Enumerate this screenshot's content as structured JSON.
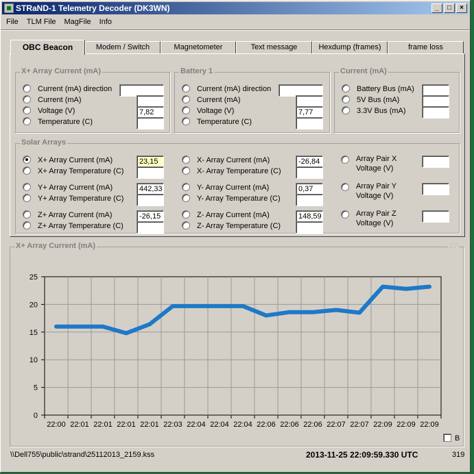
{
  "window": {
    "title": "STRaND-1 Telemetry Decoder (DK3WN)",
    "minimize": "_",
    "maximize": "□",
    "close": "×"
  },
  "menu": [
    "File",
    "TLM File",
    "MagFile",
    "Info"
  ],
  "tabs": [
    "OBC Beacon",
    "Modem / Switch",
    "Magnetometer",
    "Text message",
    "Hexdump (frames)",
    "frame loss"
  ],
  "xplus": {
    "title": "X+ Array Current (mA)",
    "rows": [
      {
        "label": "Current (mA) direction",
        "value": ""
      },
      {
        "label": "Current (mA)",
        "value": ""
      },
      {
        "label": "Voltage (V)",
        "value": "7,82"
      },
      {
        "label": "Temperature (C)",
        "value": ""
      }
    ]
  },
  "battery": {
    "title": "Battery 1",
    "rows": [
      {
        "label": "Current (mA) direction",
        "value": ""
      },
      {
        "label": "Current (mA)",
        "value": ""
      },
      {
        "label": "Voltage (V)",
        "value": "7,77"
      },
      {
        "label": "Temperature (C)",
        "value": ""
      }
    ]
  },
  "current": {
    "title": "Current (mA)",
    "rows": [
      {
        "label": "Battery Bus (mA)",
        "value": ""
      },
      {
        "label": "5V Bus (mA)",
        "value": ""
      },
      {
        "label": "3.3V Bus (mA)",
        "value": ""
      }
    ]
  },
  "solar": {
    "title": "Solar Arrays",
    "col1": [
      {
        "label": "X+ Array Current (mA)",
        "value": "23,15"
      },
      {
        "label": "X+ Array Temperature (C)",
        "value": ""
      },
      {
        "label": "Y+ Array Current (mA)",
        "value": "442,33"
      },
      {
        "label": "Y+ Array Temperature (C)",
        "value": ""
      },
      {
        "label": "Z+ Array Current (mA)",
        "value": "-26,15"
      },
      {
        "label": "Z+ Array Temperature (C)",
        "value": ""
      }
    ],
    "col2": [
      {
        "label": "X- Array Current (mA)",
        "value": "-26,84"
      },
      {
        "label": "X- Array Temperature (C)",
        "value": ""
      },
      {
        "label": "Y- Array Current (mA)",
        "value": "0,37"
      },
      {
        "label": "Y- Array Temperature (C)",
        "value": ""
      },
      {
        "label": "Z- Array Current (mA)",
        "value": "148,59"
      },
      {
        "label": "Z- Array Temperature (C)",
        "value": ""
      }
    ],
    "col3": [
      {
        "line1": "Array Pair X",
        "line2": "Voltage (V)",
        "value": ""
      },
      {
        "line1": "Array Pair Y",
        "line2": "Voltage (V)",
        "value": ""
      },
      {
        "line1": "Array Pair Z",
        "line2": "Voltage (V)",
        "value": ""
      }
    ]
  },
  "chart_panel": {
    "title": "X+ Array Current (mA)",
    "count": "17",
    "checkbox_label": "B"
  },
  "status": {
    "path": "\\\\Dell755\\public\\strand\\25112013_2159.kss",
    "datetime": "2013-11-25  22:09:59.330 UTC",
    "count": "319"
  },
  "colors": {
    "series": "#1f78c8",
    "titlebar_start": "#0a246a",
    "highlight": "#ffffc0"
  },
  "chart_data": {
    "type": "line",
    "title": "X+ Array Current (mA)",
    "xlabel": "",
    "ylabel": "",
    "ylim": [
      0,
      25
    ],
    "yticks": [
      0,
      5,
      10,
      15,
      20,
      25
    ],
    "categories": [
      "22:00",
      "22:01",
      "22:01",
      "22:01",
      "22:01",
      "22:03",
      "22:04",
      "22:04",
      "22:04",
      "22:06",
      "22:06",
      "22:06",
      "22:07",
      "22:07",
      "22:09",
      "22:09",
      "22:09"
    ],
    "values": [
      16.0,
      16.0,
      16.0,
      14.8,
      16.4,
      19.7,
      19.7,
      19.7,
      19.7,
      18.0,
      18.6,
      18.6,
      19.0,
      18.5,
      23.2,
      22.8,
      23.2
    ],
    "grid": true,
    "legend": "none"
  }
}
